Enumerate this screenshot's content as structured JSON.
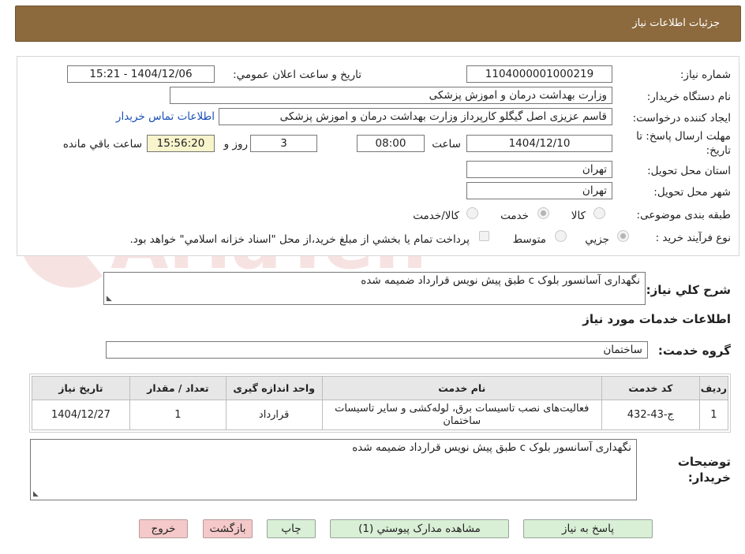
{
  "header": {
    "title": "جزئیات اطلاعات نیاز"
  },
  "form": {
    "need_number_label": "شماره نیاز:",
    "need_number": "1104000001000219",
    "announce_label": "تاریخ و ساعت اعلان عمومي:",
    "announce_value": "1404/12/06 - 15:21",
    "buyer_org_label": "نام دستگاه خريدار:",
    "buyer_org": "وزارت بهداشت  درمان و اموزش پزشکی",
    "requester_label": "ايجاد كننده درخواست:",
    "requester": "قاسم عزیزی اصل گیگلو کارپرداز وزارت بهداشت  درمان و اموزش پزشکی",
    "contact_link": "اطلاعات تماس خريدار",
    "deadline_label_1": "مهلت ارسال پاسخ: تا",
    "deadline_label_2": "تاريخ:",
    "deadline_date": "1404/12/10",
    "time_label": "ساعت",
    "deadline_time": "08:00",
    "days_value": "3",
    "days_label": "روز و",
    "remaining_time": "15:56:20",
    "remaining_label": "ساعت باقي مانده",
    "province_label": "استان محل تحويل:",
    "province": "تهران",
    "city_label": "شهر محل تحويل:",
    "city": "تهران",
    "category_label": "طبقه بندی موضوعی:",
    "category_options": [
      "کالا",
      "خدمت",
      "کالا/خدمت"
    ],
    "category_selected": "خدمت",
    "process_label": "نوع فرآيند خريد :",
    "process_options": [
      "جزيي",
      "متوسط"
    ],
    "process_selected": "جزيي",
    "payment_note": "پرداخت تمام يا بخشي از مبلغ خريد،از محل \"اسناد خزانه اسلامي\" خواهد بود."
  },
  "summary": {
    "label": "شرح كلي نياز:",
    "text": "نگهداری آسانسور بلوک c طبق پیش نویس قرارداد ضمیمه شده"
  },
  "services": {
    "section_title": "اطلاعات خدمات مورد نياز",
    "group_label": "گروه خدمت:",
    "group_value": "ساختمان",
    "columns": [
      "رديف",
      "کد خدمت",
      "نام خدمت",
      "واحد اندازه گيری",
      "تعداد / مقدار",
      "تاريخ نياز"
    ],
    "rows": [
      {
        "index": "1",
        "code": "ج-43-432",
        "name": "فعالیت‌های نصب تاسیسات برق، لوله‌کشی و سایر تاسیسات ساختمان",
        "unit": "قرارداد",
        "qty": "1",
        "date": "1404/12/27"
      }
    ]
  },
  "buyer_notes": {
    "label_1": "توضيحات",
    "label_2": "خريدار:",
    "text": "نگهداری آسانسور بلوک c طبق پیش نویس قرارداد ضمیمه شده"
  },
  "buttons": {
    "reply": "پاسخ به نياز",
    "attachments": "مشاهده مدارک پيوستي (1)",
    "print": "چاپ",
    "back": "بازگشت",
    "exit": "خروج"
  },
  "colors": {
    "header": "#8c6a3e",
    "button_green": "#d9efd6",
    "button_pink": "#f5c9c9",
    "highlight_yellow": "#f8f4cc",
    "link_blue": "#1a4fb8"
  }
}
